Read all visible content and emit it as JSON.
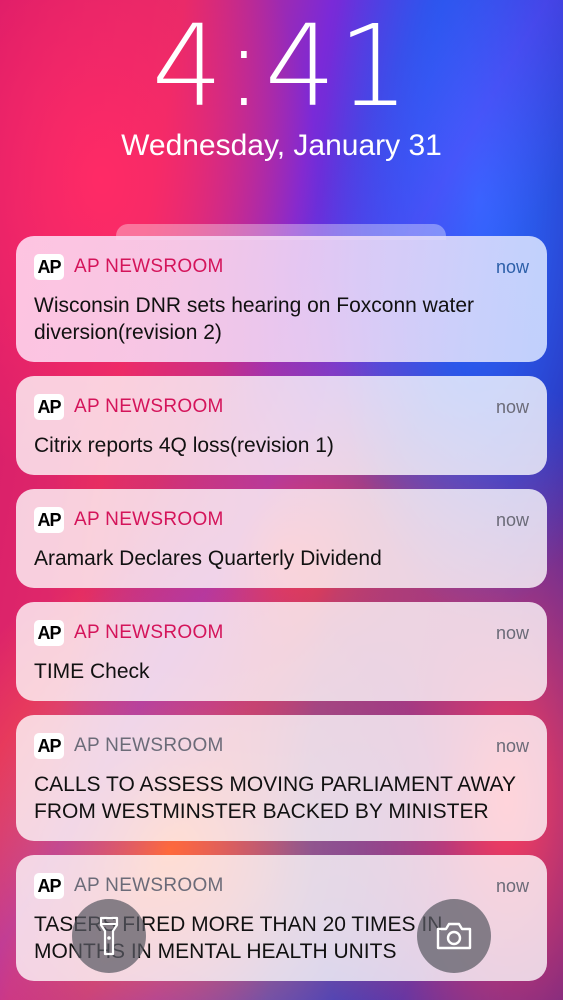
{
  "lockscreen": {
    "time": "4:41",
    "date": "Wednesday, January 31"
  },
  "notifications": [
    {
      "icon": "AP",
      "app": "AP NEWSROOM",
      "time": "now",
      "text": "Wisconsin DNR sets hearing on Foxconn water diversion(revision 2)"
    },
    {
      "icon": "AP",
      "app": "AP NEWSROOM",
      "time": "now",
      "text": "Citrix reports 4Q loss(revision 1)"
    },
    {
      "icon": "AP",
      "app": "AP NEWSROOM",
      "time": "now",
      "text": "Aramark Declares Quarterly Dividend"
    },
    {
      "icon": "AP",
      "app": "AP NEWSROOM",
      "time": "now",
      "text": "TIME Check"
    },
    {
      "icon": "AP",
      "app": "AP NEWSROOM",
      "time": "now",
      "text": "CALLS TO ASSESS MOVING PARLIAMENT AWAY FROM WESTMINSTER BACKED BY MINISTER"
    },
    {
      "icon": "AP",
      "app": "AP NEWSROOM",
      "time": "now",
      "text": "TASERS FIRED MORE THAN 20 TIMES IN MONTHS IN MENTAL HEALTH UNITS"
    }
  ],
  "controls": {
    "flashlight_icon": "flashlight-icon",
    "camera_icon": "camera-icon"
  },
  "colors": {
    "accent_app_name": "#d4145a",
    "accent_time": "#2c5fa8",
    "muted": "#6b6b78"
  }
}
